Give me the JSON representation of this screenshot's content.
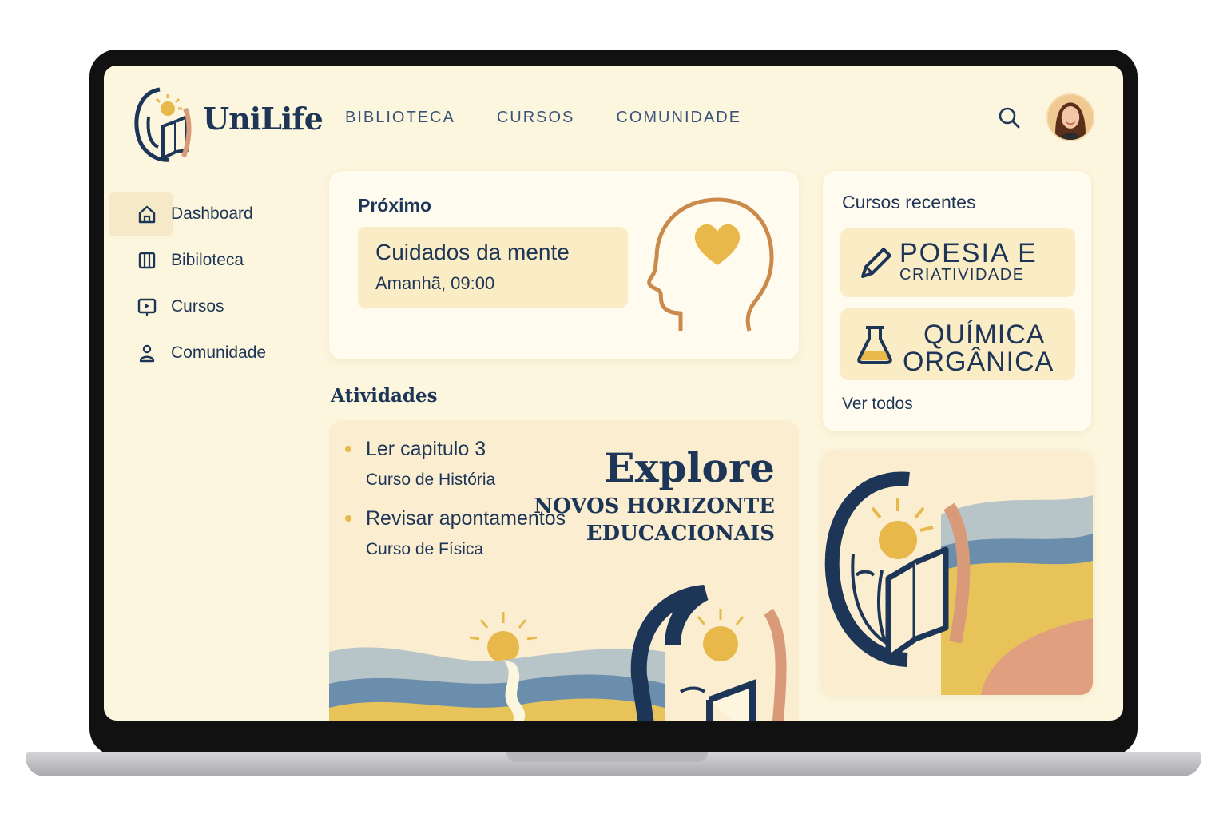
{
  "app": {
    "name": "UniLife"
  },
  "topnav": {
    "items": [
      "BIBLIOTECA",
      "CURSOS",
      "COMUNIDADE"
    ]
  },
  "sidebar": {
    "items": [
      {
        "label": "Dashboard",
        "icon": "home-icon"
      },
      {
        "label": "Bibiloteca",
        "icon": "library-icon"
      },
      {
        "label": "Cursos",
        "icon": "video-icon"
      },
      {
        "label": "Comunidade",
        "icon": "person-icon"
      }
    ]
  },
  "next": {
    "title": "Próximo",
    "name": "Cuidados da mente",
    "time": "Amanhã, 09:00"
  },
  "activities": {
    "title": "Atividades",
    "items": [
      {
        "name": "Ler capitulo 3",
        "course": "Curso de História"
      },
      {
        "name": "Revisar apontamentos",
        "course": "Curso de Física"
      }
    ]
  },
  "promo": {
    "line1": "Explore",
    "line2": "NOVOS HORIZONTE",
    "line3": "EDUCACIONAIS"
  },
  "recent": {
    "title": "Cursos recentes",
    "courses": [
      {
        "line1": "POESIA E",
        "line2": "CRIATIVIDADE",
        "icon": "pen-icon"
      },
      {
        "line1": "QUÍMICA",
        "line2": "ORGÂNICA",
        "icon": "flask-icon"
      }
    ],
    "see_all": "Ver todos"
  },
  "colors": {
    "navy": "#1d3557",
    "gold": "#e8b84a",
    "background": "#fdf6de",
    "terracotta": "#d89a78"
  }
}
